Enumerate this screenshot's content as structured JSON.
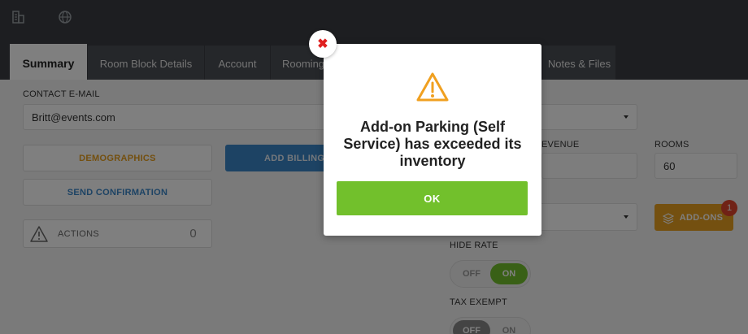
{
  "tabs": [
    {
      "label": "Summary",
      "active": true
    },
    {
      "label": "Room Block Details"
    },
    {
      "label": "Account"
    },
    {
      "label": "Rooming"
    },
    {
      "label": "Notes & Files"
    }
  ],
  "form": {
    "contact_email_label": "CONTACT E-MAIL",
    "contact_email_value": "Britt@events.com",
    "demographics_label": "DEMOGRAPHICS",
    "add_billing_label": "ADD BILLING IN",
    "send_confirmation_label": "SEND CONFIRMATION",
    "actions_label": "ACTIONS",
    "actions_count": "0",
    "revenue_label": "EVENUE",
    "rooms_label": "ROOMS",
    "rooms_value": "60",
    "addons_label": "ADD-ONS",
    "addons_badge": "1",
    "hide_rate_label": "HIDE RATE",
    "hide_rate_off": "OFF",
    "hide_rate_on": "ON",
    "tax_exempt_label": "TAX EXEMPT",
    "tax_exempt_off": "OFF",
    "tax_exempt_on": "ON"
  },
  "modal": {
    "icon": "warning-triangle-icon",
    "message": "Add-on Parking (Self Service) has exceeded its inventory",
    "ok_label": "OK",
    "close_icon": "close-icon"
  },
  "colors": {
    "accent_orange": "#e8a020",
    "accent_blue": "#3a86c8",
    "ok_green": "#72c02c",
    "close_red": "#e02020"
  }
}
